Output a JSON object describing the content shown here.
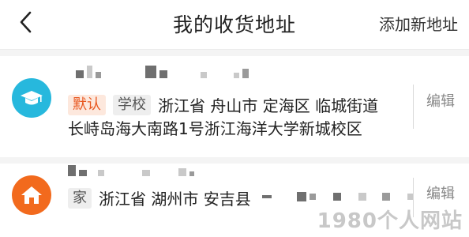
{
  "header": {
    "title": "我的收货地址",
    "add_label": "添加新地址",
    "back_icon": "chevron-left-icon"
  },
  "addresses": [
    {
      "avatar_icon": "graduation-cap-icon",
      "avatar_color": "#27b8dd",
      "tags": [
        "默认",
        "学校"
      ],
      "region": "浙江省 舟山市 定海区 临城街道",
      "detail": "长峙岛海大南路1号浙江海洋大学新城校区",
      "edit_label": "编辑"
    },
    {
      "avatar_icon": "home-icon",
      "avatar_color": "#f26a1d",
      "tags": [
        "家"
      ],
      "region": "浙江省 湖州市 安吉县",
      "detail": "",
      "edit_label": "编辑"
    }
  ],
  "watermark": "1980个人网站",
  "colors": {
    "tag_default_text": "#e8561e",
    "tag_default_bg": "#fde8dd",
    "divider": "#f4f4f4"
  }
}
